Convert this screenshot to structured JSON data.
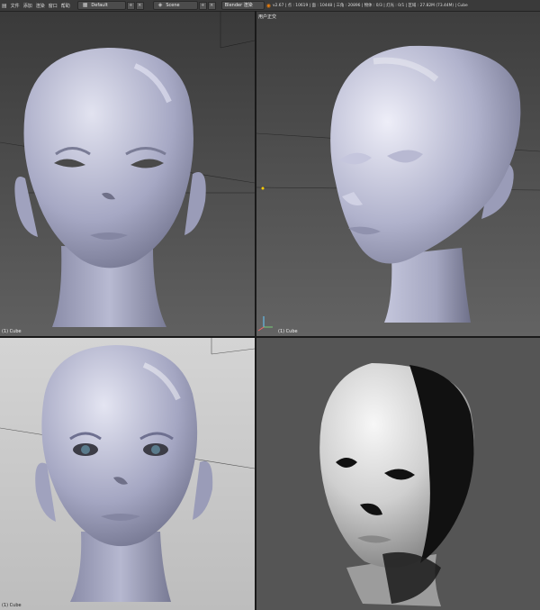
{
  "topbar": {
    "menu": [
      "文件",
      "添加",
      "渲染",
      "窗口",
      "帮助"
    ],
    "layout_value": "Default",
    "scene_value": "Scene",
    "engine_value": "Blender 渲染",
    "stats": "v2.67 | 点 : 10619 | 面 : 10448 | 三角 : 20896 | 物体 : 0/3 | 灯光 : 0/1 | 区域 : 27.82M (73.44M) | Cube",
    "icons": [
      "blender-logo-icon",
      "layout-icon",
      "scene-icon",
      "engine-icon"
    ]
  },
  "viewports": {
    "top_left": {
      "object_label": "(1) Cube"
    },
    "top_right": {
      "view_label": "用户正交",
      "object_label": "(1) Cube"
    },
    "bottom_left": {
      "object_label": "(1) Cube"
    },
    "bottom_right": {}
  },
  "colors": {
    "header": "#3a3a3a",
    "viewport_bg_top": "#3d3d3d",
    "viewport_bg_bottom": "#5c5c5c",
    "render_bg": "#555555",
    "grey_bg": "#c9c9c9",
    "mesh": "#a6a8c4"
  }
}
